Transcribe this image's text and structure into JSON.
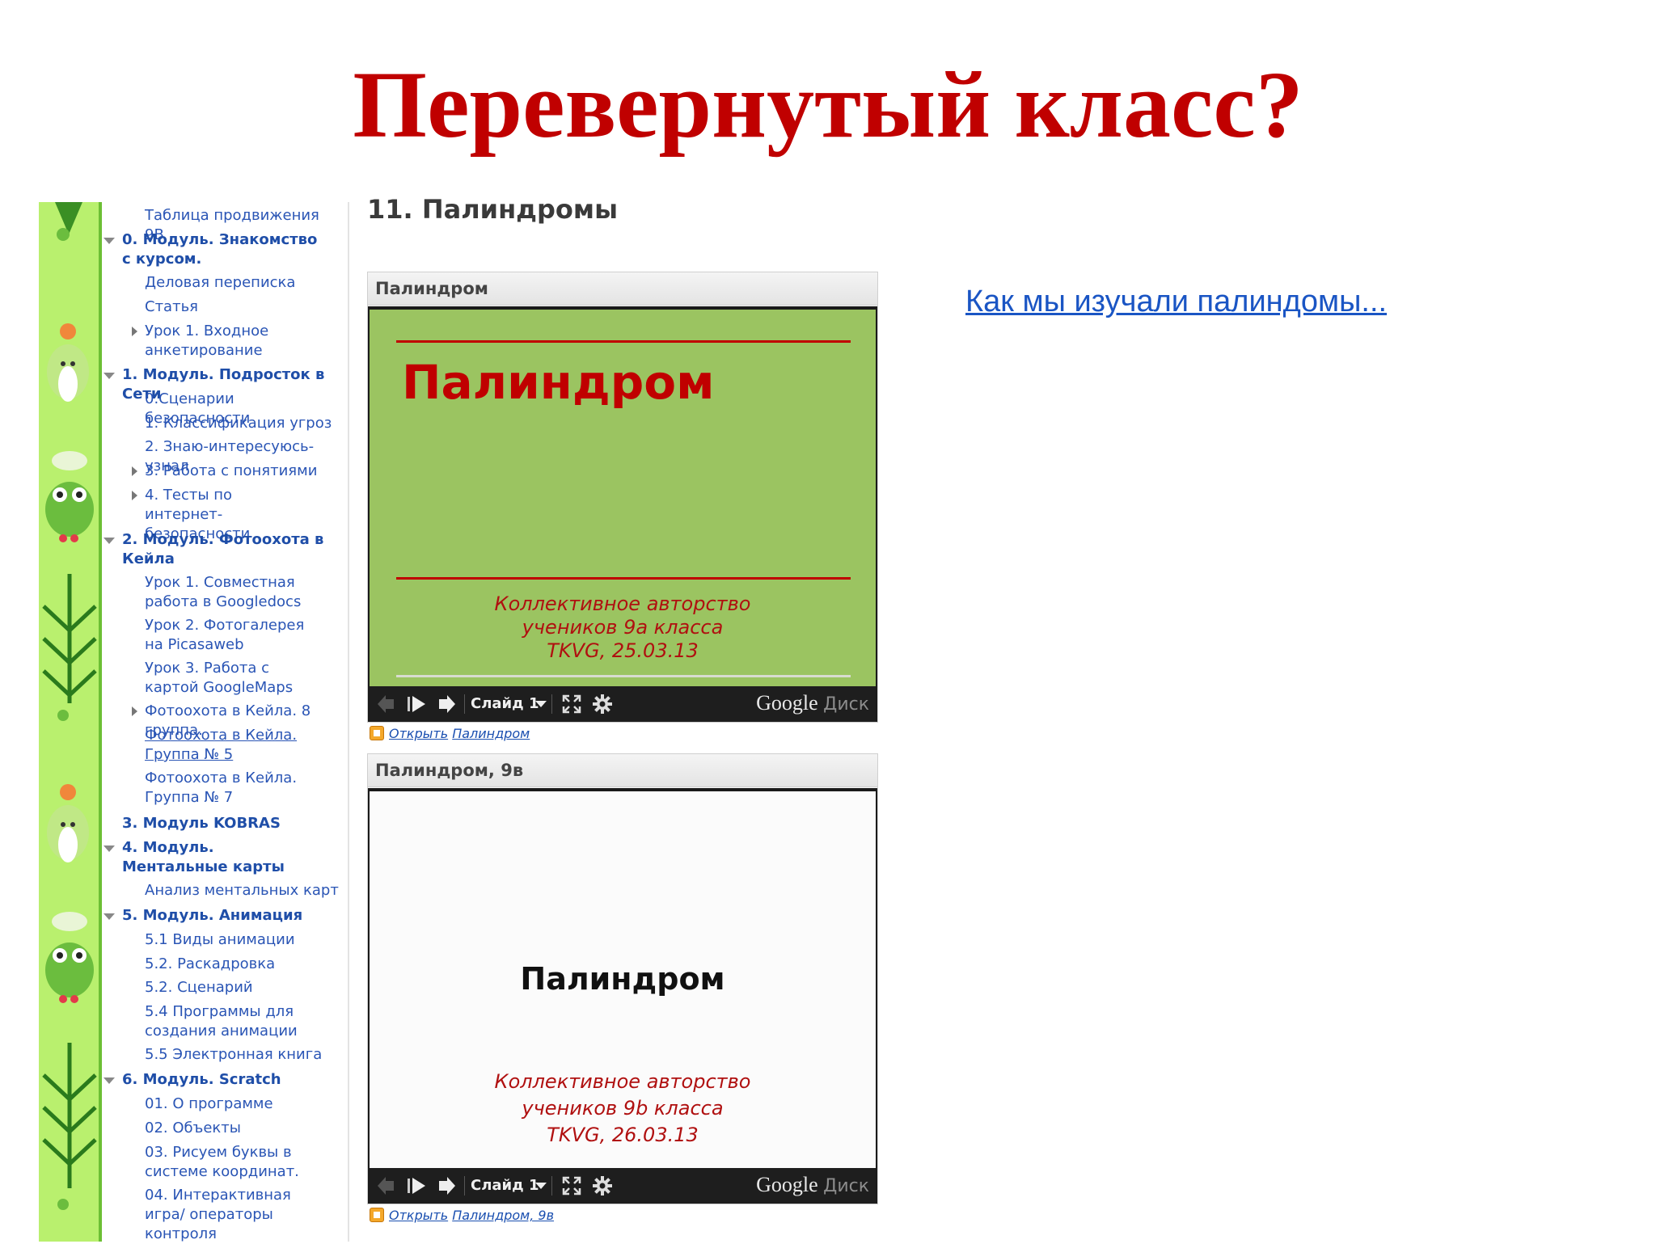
{
  "slide": {
    "title": "Перевернутый класс?"
  },
  "nav": {
    "items": [
      {
        "label": "Таблица продвижения 9В",
        "kind": "lesson"
      },
      {
        "label": "0. Модуль. Знакомство с курсом.",
        "kind": "module"
      },
      {
        "label": "Деловая переписка",
        "kind": "lesson"
      },
      {
        "label": "Статья",
        "kind": "lesson"
      },
      {
        "label": "Урок 1. Входное анкетирование",
        "kind": "lesson"
      },
      {
        "label": "1. Модуль. Подросток в Сети",
        "kind": "module"
      },
      {
        "label": "0.Сценарии безопасности",
        "kind": "lesson"
      },
      {
        "label": "1. Классификация угроз",
        "kind": "lesson"
      },
      {
        "label": "2. Знаю-интересуюсь-узнал",
        "kind": "lesson"
      },
      {
        "label": "3. Работа с понятиями",
        "kind": "lesson"
      },
      {
        "label": "4. Тесты по интернет-безопасности",
        "kind": "lesson"
      },
      {
        "label": "2. Модуль. Фотоохота в Кейла",
        "kind": "module"
      },
      {
        "label": "Урок 1. Совместная работа в Googledocs",
        "kind": "lesson"
      },
      {
        "label": "Урок 2. Фотогалерея на Picasaweb",
        "kind": "lesson"
      },
      {
        "label": "Урок 3. Работа с картой GoogleMaps",
        "kind": "lesson"
      },
      {
        "label": "Фотоохота в Кейла. 8 группа.",
        "kind": "lesson"
      },
      {
        "label": "Фотоохота в Кейла. Группа № 5",
        "kind": "lesson"
      },
      {
        "label": "Фотоохота в Кейла. Группа № 7",
        "kind": "lesson"
      },
      {
        "label": "3. Модуль KOBRAS",
        "kind": "module"
      },
      {
        "label": "4. Модуль. Ментальные карты",
        "kind": "module"
      },
      {
        "label": "Анализ ментальных карт",
        "kind": "lesson"
      },
      {
        "label": "5. Модуль. Анимация",
        "kind": "module"
      },
      {
        "label": "5.1 Виды анимации",
        "kind": "lesson"
      },
      {
        "label": "5.2. Раскадровка",
        "kind": "lesson"
      },
      {
        "label": "5.2. Сценарий",
        "kind": "lesson"
      },
      {
        "label": "5.4 Программы для создания анимации",
        "kind": "lesson"
      },
      {
        "label": "5.5 Электронная книга",
        "kind": "lesson"
      },
      {
        "label": "6. Модуль. Scratch",
        "kind": "module"
      },
      {
        "label": "01. О программе",
        "kind": "lesson"
      },
      {
        "label": "02. Объекты",
        "kind": "lesson"
      },
      {
        "label": "03. Рисуем буквы в системе координат.",
        "kind": "lesson"
      },
      {
        "label": "04. Интерактивная игра/ операторы контроля",
        "kind": "lesson"
      }
    ]
  },
  "content": {
    "section_title": "11. Палиндромы",
    "external_link": "Как мы изучали палиндомы...",
    "embeds": [
      {
        "header": "Палиндром",
        "slide_title": "Палиндром",
        "caption": [
          "Коллективное авторство",
          "учеников 9а класса",
          "TKVG, 25.03.13"
        ],
        "slide_counter": "Слайд 1",
        "brand": "Google",
        "brand_suffix": "Диск",
        "open_prefix": "Открыть",
        "open_name": "Палиндром"
      },
      {
        "header": "Палиндром, 9в",
        "slide_title": "Палиндром",
        "caption": [
          "Коллективное авторство",
          "учеников 9b класса",
          "TKVG, 26.03.13"
        ],
        "slide_counter": "Слайд 1",
        "brand": "Google",
        "brand_suffix": "Диск",
        "open_prefix": "Открыть",
        "open_name": "Палиндром, 9в"
      }
    ]
  },
  "icons": {
    "toolbar": [
      "prev-icon",
      "play-icon",
      "next-icon",
      "dropdown-icon",
      "fullscreen-icon",
      "gear-icon"
    ],
    "embed_open": "google-slides-icon",
    "tree": [
      "expand-triangle-icon",
      "collapse-triangle-icon"
    ]
  },
  "colors": {
    "title_red": "#c00000",
    "slide_green": "#9bc461",
    "link_blue": "#1a55c4"
  }
}
